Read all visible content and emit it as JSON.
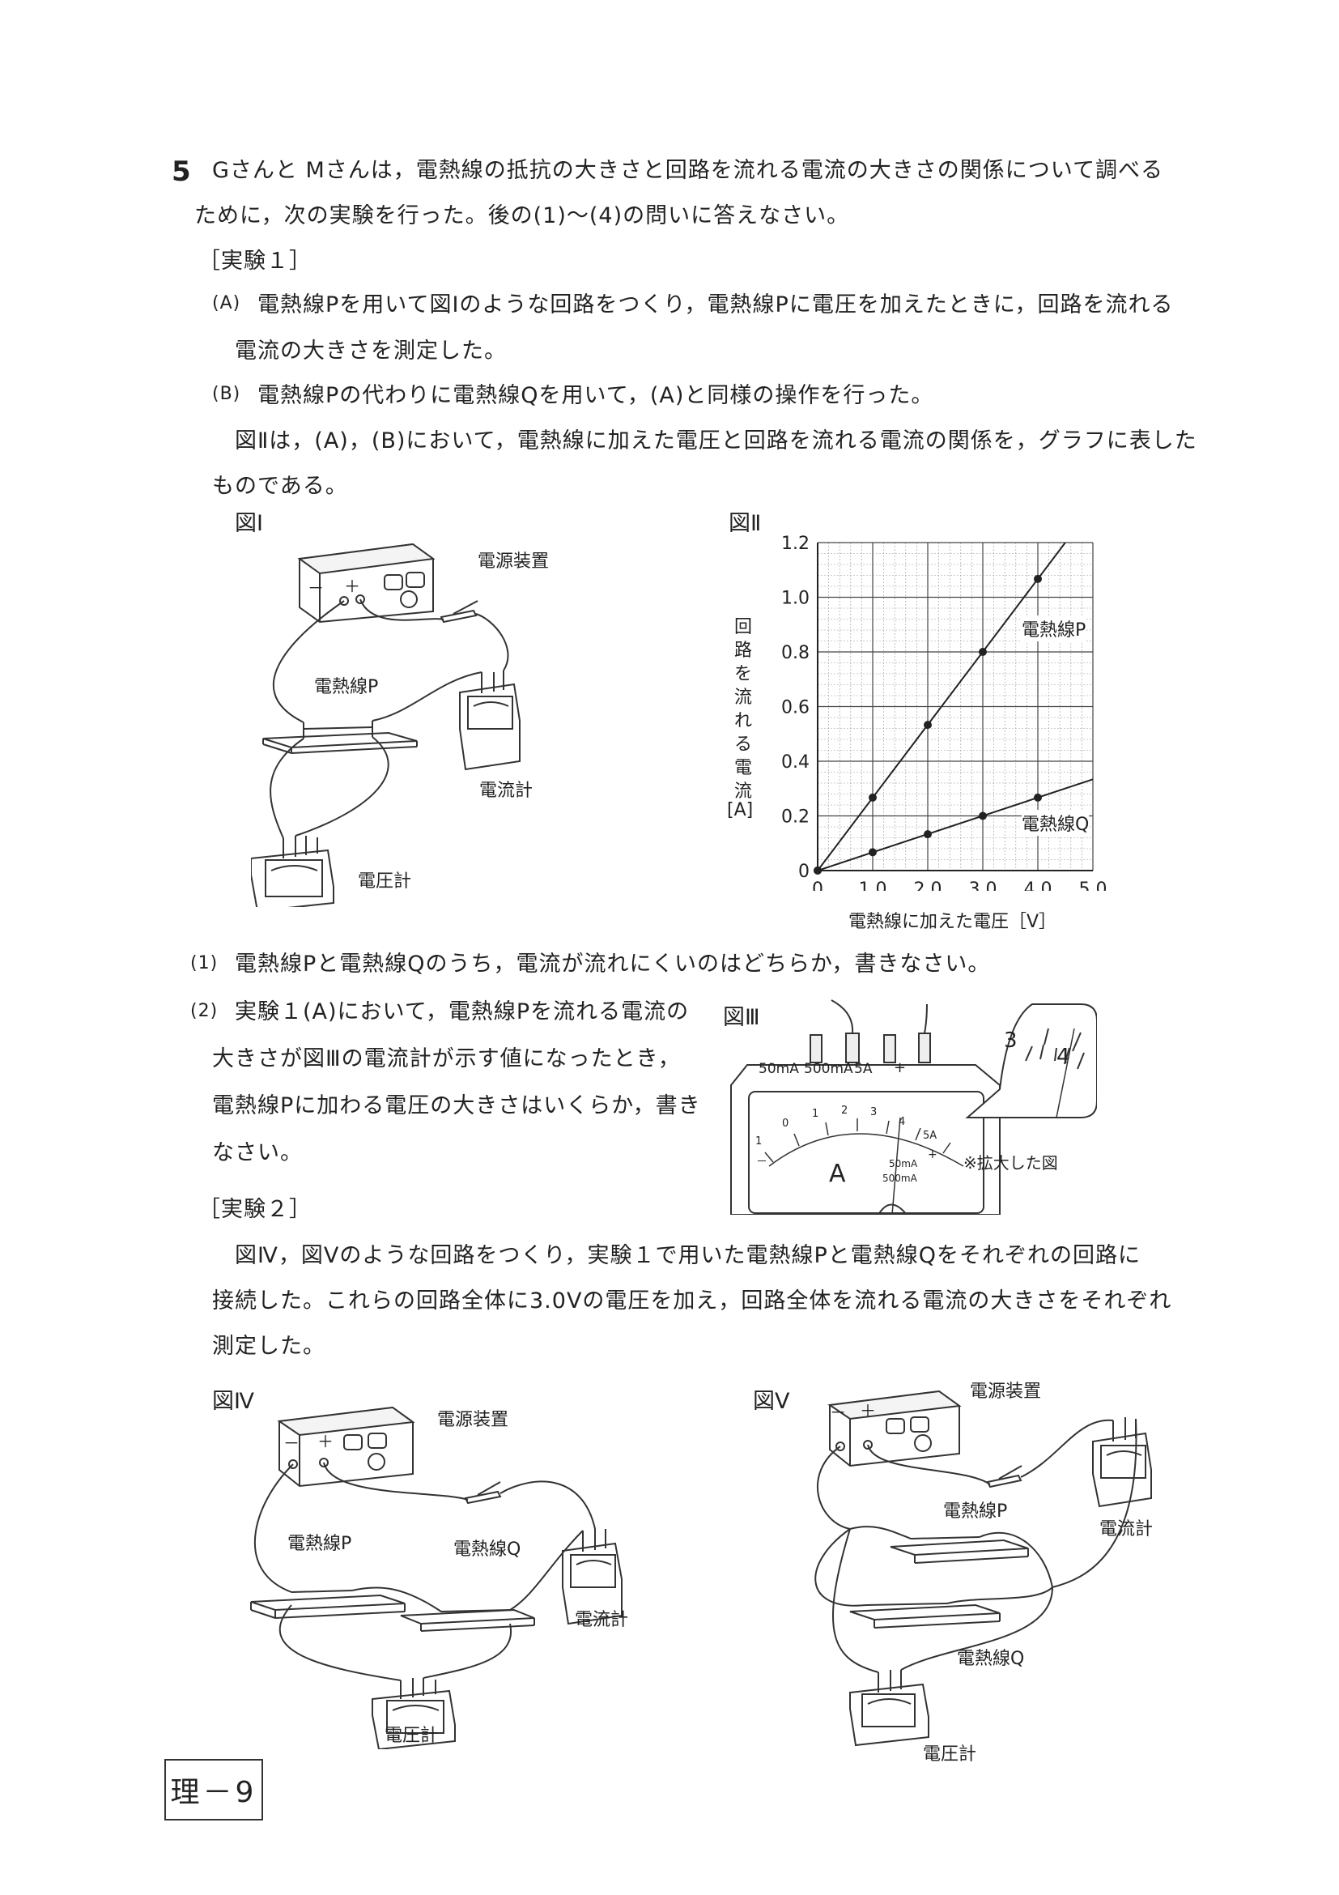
{
  "question": {
    "number": "5",
    "intro_line1": "Gさんと Mさんは，電熱線の抵抗の大きさと回路を流れる電流の大きさの関係について調べる",
    "intro_line2": "ために，次の実験を行った。後の(1)～(4)の問いに答えなさい。"
  },
  "exp1": {
    "heading": "［実験１］",
    "a_mark": "(A)",
    "a_line1": "電熱線Pを用いて図Ⅰのような回路をつくり，電熱線Pに電圧を加えたときに，回路を流れる",
    "a_line2": "電流の大きさを測定した。",
    "b_mark": "(B)",
    "b_line1": "電熱線Pの代わりに電熱線Qを用いて，(A)と同様の操作を行った。",
    "desc_line1": "図Ⅱは，(A)，(B)において，電熱線に加えた電圧と回路を流れる電流の関係を，グラフに表した",
    "desc_line2": "ものである。"
  },
  "fig1": {
    "label": "図Ⅰ",
    "power_supply": "電源装置",
    "minus": "－",
    "plus": "＋",
    "wire_p": "電熱線P",
    "ammeter": "電流計",
    "voltmeter": "電圧計"
  },
  "fig2": {
    "label": "図Ⅱ",
    "ylabel_chars": [
      "回",
      "路",
      "を",
      "流",
      "れ",
      "る",
      "電",
      "流"
    ],
    "yunit": "[A]",
    "xlabel": "電熱線に加えた電圧［V］",
    "series_p": "電熱線P",
    "series_q": "電熱線Q"
  },
  "chart_data": {
    "type": "line",
    "title": "",
    "xlabel": "電熱線に加えた電圧［V］",
    "ylabel": "回路を流れる電流 [A]",
    "xlim": [
      0,
      5.0
    ],
    "ylim": [
      0,
      1.2
    ],
    "xticks": [
      "0",
      "1.0",
      "2.0",
      "3.0",
      "4.0",
      "5.0"
    ],
    "yticks": [
      "0",
      "0.2",
      "0.4",
      "0.6",
      "0.8",
      "1.0",
      "1.2"
    ],
    "grid": true,
    "series": [
      {
        "name": "電熱線P",
        "x": [
          0,
          1.0,
          2.0,
          3.0,
          4.0
        ],
        "y": [
          0,
          0.267,
          0.533,
          0.8,
          1.067
        ]
      },
      {
        "name": "電熱線Q",
        "x": [
          0,
          1.0,
          2.0,
          3.0,
          4.0
        ],
        "y": [
          0,
          0.067,
          0.133,
          0.2,
          0.267
        ]
      }
    ]
  },
  "q1": {
    "mark": "(1)",
    "text": "電熱線Pと電熱線Qのうち，電流が流れにくいのはどちらか，書きなさい。"
  },
  "q2": {
    "mark": "(2)",
    "line1": "実験１(A)において，電熱線Pを流れる電流の",
    "line2": "大きさが図Ⅲの電流計が示す値になったとき，",
    "line3": "電熱線Pに加わる電圧の大きさはいくらか，書き",
    "line4": "なさい。"
  },
  "fig3": {
    "label": "図Ⅲ",
    "terminals": [
      "50mA",
      "500mA",
      "5A",
      "+"
    ],
    "scale_numbers": [
      "1",
      "0",
      "1",
      "2",
      "3",
      "4",
      "5A"
    ],
    "scale_minus": "－",
    "scale_plus": "+",
    "range_50ma": "50mA",
    "range_500ma": "500mA",
    "unit": "A",
    "zoom_3": "3",
    "zoom_4": "4",
    "zoom_note": "※拡大した図"
  },
  "exp2": {
    "heading": "［実験２］",
    "line1": "図Ⅳ，図Ⅴのような回路をつくり，実験１で用いた電熱線Pと電熱線Qをそれぞれの回路に",
    "line2": "接続した。これらの回路全体に3.0Vの電圧を加え，回路全体を流れる電流の大きさをそれぞれ",
    "line3": "測定した。"
  },
  "fig4": {
    "label": "図Ⅳ",
    "power_supply": "電源装置",
    "minus": "－",
    "plus": "＋",
    "wire_p": "電熱線P",
    "wire_q": "電熱線Q",
    "ammeter": "電流計",
    "voltmeter": "電圧計"
  },
  "fig5": {
    "label": "図Ⅴ",
    "power_supply": "電源装置",
    "minus": "－",
    "plus": "＋",
    "wire_p": "電熱線P",
    "wire_q": "電熱線Q",
    "ammeter": "電流計",
    "voltmeter": "電圧計"
  },
  "footer": {
    "page": "理－9"
  }
}
